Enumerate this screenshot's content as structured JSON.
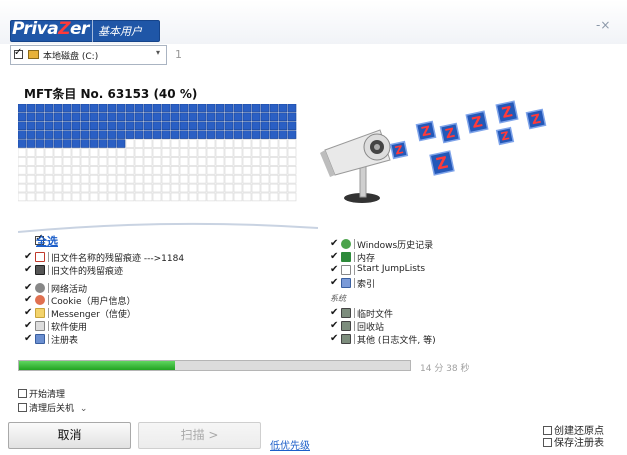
{
  "header": {
    "logo_prefix": "Priva",
    "logo_z": "Z",
    "logo_suffix": "er",
    "mode": "基本用户",
    "window_controls": "-×"
  },
  "drive": {
    "checked": true,
    "label": "本地磁盘 (C:)",
    "count": "1"
  },
  "mft": {
    "title": "MFT条目 No. 63153 (40 %)",
    "grid_filled_fraction": 0.4
  },
  "options": {
    "select_all": "全选",
    "left": [
      {
        "checked": true,
        "icon": "doc-red-icon",
        "label": "旧文件名称的残留痕迹 --->1184"
      },
      {
        "checked": true,
        "icon": "doc-dark-icon",
        "label": "旧文件的残留痕迹"
      },
      {
        "checked": true,
        "icon": "globe-icon",
        "label": "网络活动"
      },
      {
        "checked": true,
        "icon": "cookie-icon",
        "label": "Cookie（用户信息）"
      },
      {
        "checked": true,
        "icon": "messenger-icon",
        "label": "Messenger（信使）"
      },
      {
        "checked": true,
        "icon": "software-icon",
        "label": "软件使用"
      },
      {
        "checked": true,
        "icon": "registry-icon",
        "label": "注册表"
      }
    ],
    "right": [
      {
        "checked": true,
        "icon": "windows-history-icon",
        "label": "Windows历史记录"
      },
      {
        "checked": true,
        "icon": "memory-icon",
        "label": "内存"
      },
      {
        "checked": true,
        "icon": "start-icon",
        "label": "Start JumpLists"
      },
      {
        "checked": true,
        "icon": "index-icon",
        "label": "索引"
      }
    ],
    "system_label": "系统",
    "system": [
      {
        "checked": true,
        "icon": "temp-files-icon",
        "label": "临时文件"
      },
      {
        "checked": true,
        "icon": "recycle-bin-icon",
        "label": "回收站"
      },
      {
        "checked": true,
        "icon": "other-icon",
        "label": "其他 (日志文件, 等)"
      }
    ]
  },
  "progress": {
    "value": 0.4,
    "time_text": "14 分 38 秒"
  },
  "bottom": {
    "start_cleanup": "开始清理",
    "shutdown_after": "清理后关机",
    "cancel": "取消",
    "scan": "扫描 >",
    "low_priority": "低优先级",
    "create_restore_point": "创建还原点",
    "save_registry": "保存注册表"
  },
  "colors": {
    "accent": "#1f56a7",
    "grid_filled": "#2a5fc4",
    "progress": "#2db42d",
    "link": "#1d5fc9"
  }
}
